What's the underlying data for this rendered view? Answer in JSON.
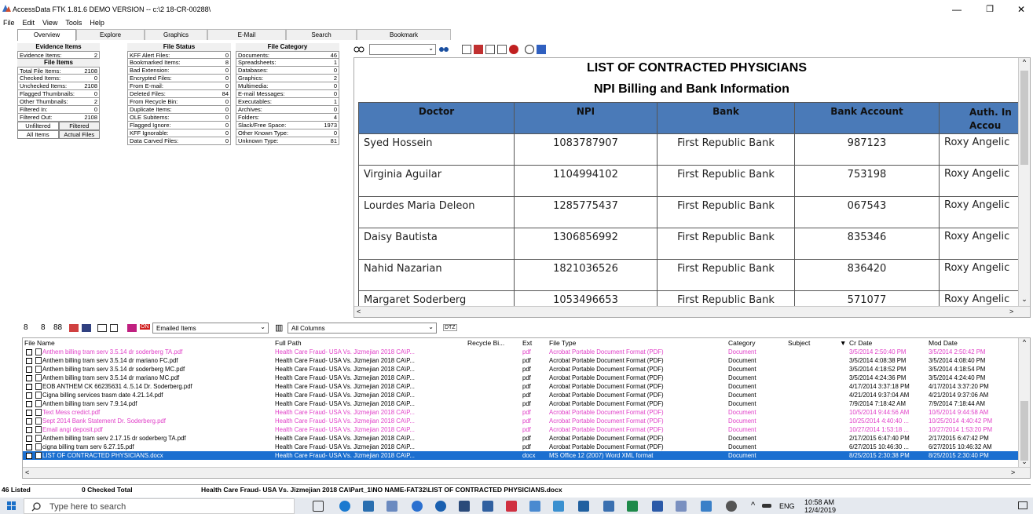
{
  "window": {
    "title": "AccessData FTK 1.81.6 DEMO VERSION -- c:\\2 18-CR-00288\\",
    "minimize": "—",
    "maximize": "❐",
    "close": "✕"
  },
  "menu": [
    "File",
    "Edit",
    "View",
    "Tools",
    "Help"
  ],
  "tabs": [
    "Overview",
    "Explore",
    "Graphics",
    "E-Mail",
    "Search",
    "Bookmark"
  ],
  "stats": {
    "evidence_items_header": "Evidence Items",
    "evidence_items": [
      {
        "label": "Evidence Items:",
        "value": "2"
      }
    ],
    "file_items_header": "File Items",
    "file_items": [
      {
        "label": "Total File Items:",
        "value": "2108"
      },
      {
        "label": "Checked Items:",
        "value": "0"
      },
      {
        "label": "Unchecked Items:",
        "value": "2108"
      },
      {
        "label": "Flagged Thumbnails:",
        "value": "0"
      },
      {
        "label": "Other Thumbnails:",
        "value": "2"
      },
      {
        "label": "Filtered In:",
        "value": "0"
      },
      {
        "label": "Filtered Out:",
        "value": "2108"
      }
    ],
    "filter_buttons": [
      "Unfiltered",
      "Filtered"
    ],
    "item_buttons": [
      "All Items",
      "Actual Files"
    ],
    "file_status_header": "File Status",
    "file_status": [
      {
        "label": "KFF Alert Files:",
        "value": "0"
      },
      {
        "label": "Bookmarked Items:",
        "value": "8"
      },
      {
        "label": "Bad Extension:",
        "value": "0"
      },
      {
        "label": "Encrypted Files:",
        "value": "0"
      },
      {
        "label": "From E-mail:",
        "value": "0"
      },
      {
        "label": "Deleted Files:",
        "value": "84"
      },
      {
        "label": "From Recycle Bin:",
        "value": "0"
      },
      {
        "label": "Duplicate Items:",
        "value": "0"
      },
      {
        "label": "OLE Subitems:",
        "value": "0"
      },
      {
        "label": "Flagged Ignore:",
        "value": "0"
      },
      {
        "label": "KFF Ignorable:",
        "value": "0"
      },
      {
        "label": "Data Carved Files:",
        "value": "0"
      }
    ],
    "file_category_header": "File Category",
    "file_category": [
      {
        "label": "Documents:",
        "value": "46"
      },
      {
        "label": "Spreadsheets:",
        "value": "1"
      },
      {
        "label": "Databases:",
        "value": "0"
      },
      {
        "label": "Graphics:",
        "value": "2"
      },
      {
        "label": "Multimedia:",
        "value": "0"
      },
      {
        "label": "E-mail Messages:",
        "value": "0"
      },
      {
        "label": "Executables:",
        "value": "1"
      },
      {
        "label": "Archives:",
        "value": "0"
      },
      {
        "label": "Folders:",
        "value": "4"
      },
      {
        "label": "Slack/Free Space:",
        "value": "1973"
      },
      {
        "label": "Other Known Type:",
        "value": "0"
      },
      {
        "label": "Unknown Type:",
        "value": "81"
      }
    ]
  },
  "viewer": {
    "doc_title": "LIST OF CONTRACTED PHYSICIANS",
    "doc_subtitle": "NPI Billing and Bank Information",
    "headers": [
      "Doctor",
      "NPI",
      "Bank",
      "Bank Account",
      "Auth. In Accou"
    ],
    "rows": [
      {
        "doctor": "Syed Hossein",
        "npi": "1083787907",
        "bank": "First Republic Bank",
        "account": "987123",
        "auth": "Roxy Angelic"
      },
      {
        "doctor": "Virginia Aguilar",
        "npi": "1104994102",
        "bank": "First Republic Bank",
        "account": "753198",
        "auth": "Roxy Angelic"
      },
      {
        "doctor": "Lourdes Maria Deleon",
        "npi": "1285775437",
        "bank": "First Republic Bank",
        "account": "067543",
        "auth": "Roxy Angelic"
      },
      {
        "doctor": "Daisy Bautista",
        "npi": "1306856992",
        "bank": "First Republic Bank",
        "account": "835346",
        "auth": "Roxy Angelic"
      },
      {
        "doctor": "Nahid Nazarian",
        "npi": "1821036526",
        "bank": "First Republic Bank",
        "account": "836420",
        "auth": "Roxy Angelic"
      },
      {
        "doctor": "Margaret Soderberg",
        "npi": "1053496653",
        "bank": "First Republic Bank",
        "account": "571077",
        "auth": "Roxy Angelic"
      }
    ]
  },
  "list_toolbar": {
    "filter_select": "Emailed Items",
    "columns_select": "All Columns",
    "dtz": "DTZ",
    "on_badge": "ON"
  },
  "file_list": {
    "columns": [
      "File Name",
      "Full Path",
      "Recycle Bi...",
      "Ext",
      "File Type",
      "Category",
      "Subject",
      "Cr Date",
      "Mod Date"
    ],
    "rows": [
      {
        "name": "Anthem billing tram serv 3.5.14 dr soderberg TA.pdf",
        "path": "Health Care Fraud- USA Vs. Jizmejian 2018 CA\\P...",
        "ext": "pdf",
        "type": "Acrobat Portable Document Format (PDF)",
        "cat": "Document",
        "cr": "3/5/2014 2:50:40 PM",
        "mod": "3/5/2014 2:50:42 PM",
        "style": "pink"
      },
      {
        "name": "Anthem billing tram serv 3.5.14 dr mariano FC.pdf",
        "path": "Health Care Fraud- USA Vs. Jizmejian 2018 CA\\P...",
        "ext": "pdf",
        "type": "Acrobat Portable Document Format (PDF)",
        "cat": "Document",
        "cr": "3/5/2014 4:08:38 PM",
        "mod": "3/5/2014 4:08:40 PM",
        "style": ""
      },
      {
        "name": "Anthem billing tram serv 3.5.14 dr soderberg MC.pdf",
        "path": "Health Care Fraud- USA Vs. Jizmejian 2018 CA\\P...",
        "ext": "pdf",
        "type": "Acrobat Portable Document Format (PDF)",
        "cat": "Document",
        "cr": "3/5/2014 4:18:52 PM",
        "mod": "3/5/2014 4:18:54 PM",
        "style": ""
      },
      {
        "name": "Anthem billing tram serv 3.5.14 dr mariano MC.pdf",
        "path": "Health Care Fraud- USA Vs. Jizmejian 2018 CA\\P...",
        "ext": "pdf",
        "type": "Acrobat Portable Document Format (PDF)",
        "cat": "Document",
        "cr": "3/5/2014 4:24:36 PM",
        "mod": "3/5/2014 4:24:40 PM",
        "style": ""
      },
      {
        "name": "EOB ANTHEM CK 66235631 4..5.14 Dr. Soderberg.pdf",
        "path": "Health Care Fraud- USA Vs. Jizmejian 2018 CA\\P...",
        "ext": "pdf",
        "type": "Acrobat Portable Document Format (PDF)",
        "cat": "Document",
        "cr": "4/17/2014 3:37:18 PM",
        "mod": "4/17/2014 3:37:20 PM",
        "style": ""
      },
      {
        "name": "Cigna billing services trasm date 4.21.14.pdf",
        "path": "Health Care Fraud- USA Vs. Jizmejian 2018 CA\\P...",
        "ext": "pdf",
        "type": "Acrobat Portable Document Format (PDF)",
        "cat": "Document",
        "cr": "4/21/2014 9:37:04 AM",
        "mod": "4/21/2014 9:37:06 AM",
        "style": ""
      },
      {
        "name": "Anthem billing tram serv 7.9.14.pdf",
        "path": "Health Care Fraud- USA Vs. Jizmejian 2018 CA\\P...",
        "ext": "pdf",
        "type": "Acrobat Portable Document Format (PDF)",
        "cat": "Document",
        "cr": "7/9/2014 7:18:42 AM",
        "mod": "7/9/2014 7:18:44 AM",
        "style": ""
      },
      {
        "name": "Text Mess credict.pdf",
        "path": "Health Care Fraud- USA Vs. Jizmejian 2018 CA\\P...",
        "ext": "pdf",
        "type": "Acrobat Portable Document Format (PDF)",
        "cat": "Document",
        "cr": "10/5/2014 9:44:56 AM",
        "mod": "10/5/2014 9:44:58 AM",
        "style": "pink"
      },
      {
        "name": "Sept 2014 Bank Statement Dr. Soderberg.pdf",
        "path": "Health Care Fraud- USA Vs. Jizmejian 2018 CA\\P...",
        "ext": "pdf",
        "type": "Acrobat Portable Document Format (PDF)",
        "cat": "Document",
        "cr": "10/25/2014 4:40:40 ...",
        "mod": "10/25/2014 4:40:42 PM",
        "style": "pink"
      },
      {
        "name": "Email angi deposit.pdf",
        "path": "Health Care Fraud- USA Vs. Jizmejian 2018 CA\\P...",
        "ext": "pdf",
        "type": "Acrobat Portable Document Format (PDF)",
        "cat": "Document",
        "cr": "10/27/2014 1:53:18 ...",
        "mod": "10/27/2014 1:53:20 PM",
        "style": "pink"
      },
      {
        "name": "Anthem billing tram serv 2.17.15 dr soderberg TA.pdf",
        "path": "Health Care Fraud- USA Vs. Jizmejian 2018 CA\\P...",
        "ext": "pdf",
        "type": "Acrobat Portable Document Format (PDF)",
        "cat": "Document",
        "cr": "2/17/2015 6:47:40 PM",
        "mod": "2/17/2015 6:47:42 PM",
        "style": ""
      },
      {
        "name": "cigna billing tram serv 6.27.15.pdf",
        "path": "Health Care Fraud- USA Vs. Jizmejian 2018 CA\\P...",
        "ext": "pdf",
        "type": "Acrobat Portable Document Format (PDF)",
        "cat": "Document",
        "cr": "6/27/2015 10:46:30 ...",
        "mod": "6/27/2015 10:46:32 AM",
        "style": ""
      },
      {
        "name": "LIST OF CONTRACTED PHYSICIANS.docx",
        "path": "Health Care Fraud- USA Vs. Jizmejian 2018 CA\\P...",
        "ext": "docx",
        "type": "MS Office 12 (2007) Word XML format",
        "cat": "Document",
        "cr": "8/25/2015 2:30:38 PM",
        "mod": "8/25/2015 2:30:40 PM",
        "style": "sel"
      }
    ]
  },
  "status": {
    "listed": "46 Listed",
    "checked": "0 Checked Total",
    "path": "Health Care Fraud- USA Vs. Jizmejian 2018 CA\\Part_1\\NO NAME-FAT32\\LIST OF CONTRACTED PHYSICIANS.docx"
  },
  "taskbar": {
    "search_placeholder": "Type here to search",
    "lang": "ENG",
    "time": "10:58 AM",
    "date": "12/4/2019"
  },
  "colors": {
    "table_header": "#4a7ab8",
    "highlight_pink": "#e040c8",
    "selection_blue": "#1b6fd0"
  }
}
